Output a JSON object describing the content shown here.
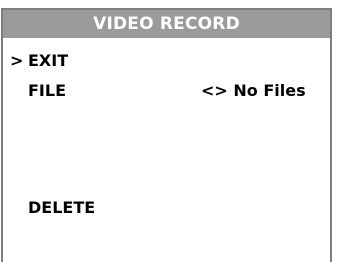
{
  "title": "VIDEO RECORD",
  "cursor": ">",
  "menu": {
    "exit_label": "EXIT",
    "file_label": "FILE",
    "file_value": "<> No Files",
    "delete_label": "DELETE"
  }
}
